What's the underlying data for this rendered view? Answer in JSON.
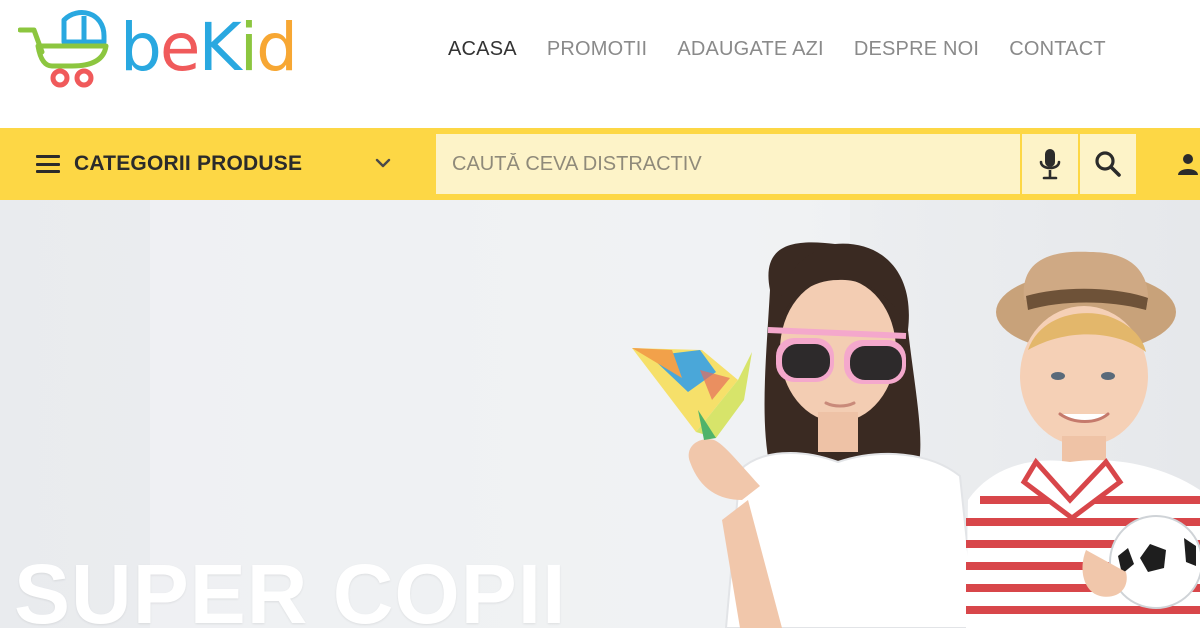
{
  "brand": {
    "name_parts": [
      "b",
      "e",
      "K",
      "i",
      "d"
    ],
    "colors": {
      "blue": "#29a8e0",
      "red": "#f05a5b",
      "green": "#8cc63f",
      "orange": "#f7a733"
    }
  },
  "nav": {
    "items": [
      {
        "label": "ACASA",
        "active": true
      },
      {
        "label": "PROMOTII",
        "active": false
      },
      {
        "label": "ADAUGATE AZI",
        "active": false
      },
      {
        "label": "DESPRE NOI",
        "active": false
      },
      {
        "label": "CONTACT",
        "active": false
      }
    ]
  },
  "toolbar": {
    "categories_label": "CATEGORII PRODUSE",
    "search_placeholder": "CAUTĂ CEVA DISTRACTIV",
    "bar_color": "#fdd745"
  },
  "icons": {
    "logo": "stroller-icon",
    "menu": "hamburger-icon",
    "dropdown": "chevron-down-icon",
    "voice": "microphone-icon",
    "search": "search-icon",
    "account": "user-icon"
  },
  "hero": {
    "title": "SUPER COPII"
  }
}
